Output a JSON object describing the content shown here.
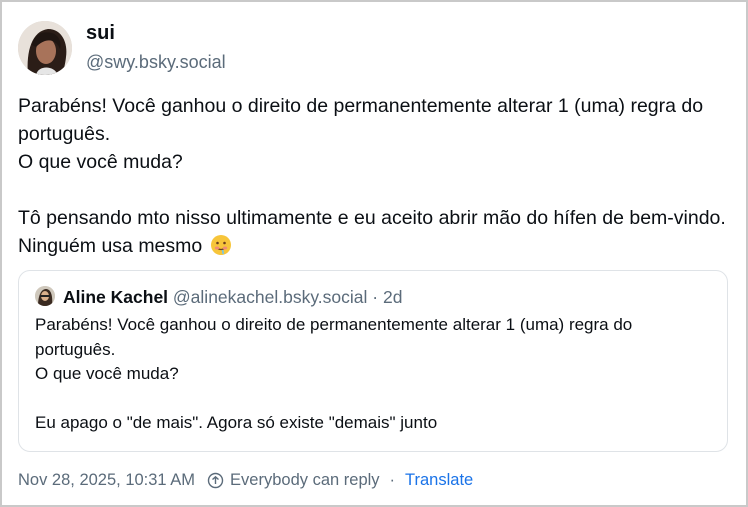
{
  "post": {
    "author_name": "sui",
    "author_handle": "@swy.bsky.social",
    "text": "Parabéns! Você ganhou o direito de permanentemente alterar 1 (uma) regra do português.\nO que você muda?\n\nTô pensando mto nisso ultimamente e eu aceito abrir mão do hífen de bem-vindo. Ninguém usa mesmo",
    "emoji_icon": "drooling-face-emoji"
  },
  "quote": {
    "author_name": "Aline Kachel",
    "author_handle": "@alinekachel.bsky.social",
    "separator": "·",
    "age": "2d",
    "text": "Parabéns! Você ganhou o direito de permanentemente alterar 1 (uma) regra do português.\nO que você muda?\n\nEu apago o \"de mais\". Agora só existe \"demais\" junto"
  },
  "footer": {
    "timestamp": "Nov 28, 2025, 10:31 AM",
    "reply_setting": "Everybody can reply",
    "separator": "·",
    "translate_label": "Translate",
    "reply_icon": "reply-circle-icon"
  },
  "colors": {
    "text": "#0b0f14",
    "muted": "#5b6b7a",
    "link": "#1a73e8",
    "border": "#dfe3e7"
  }
}
